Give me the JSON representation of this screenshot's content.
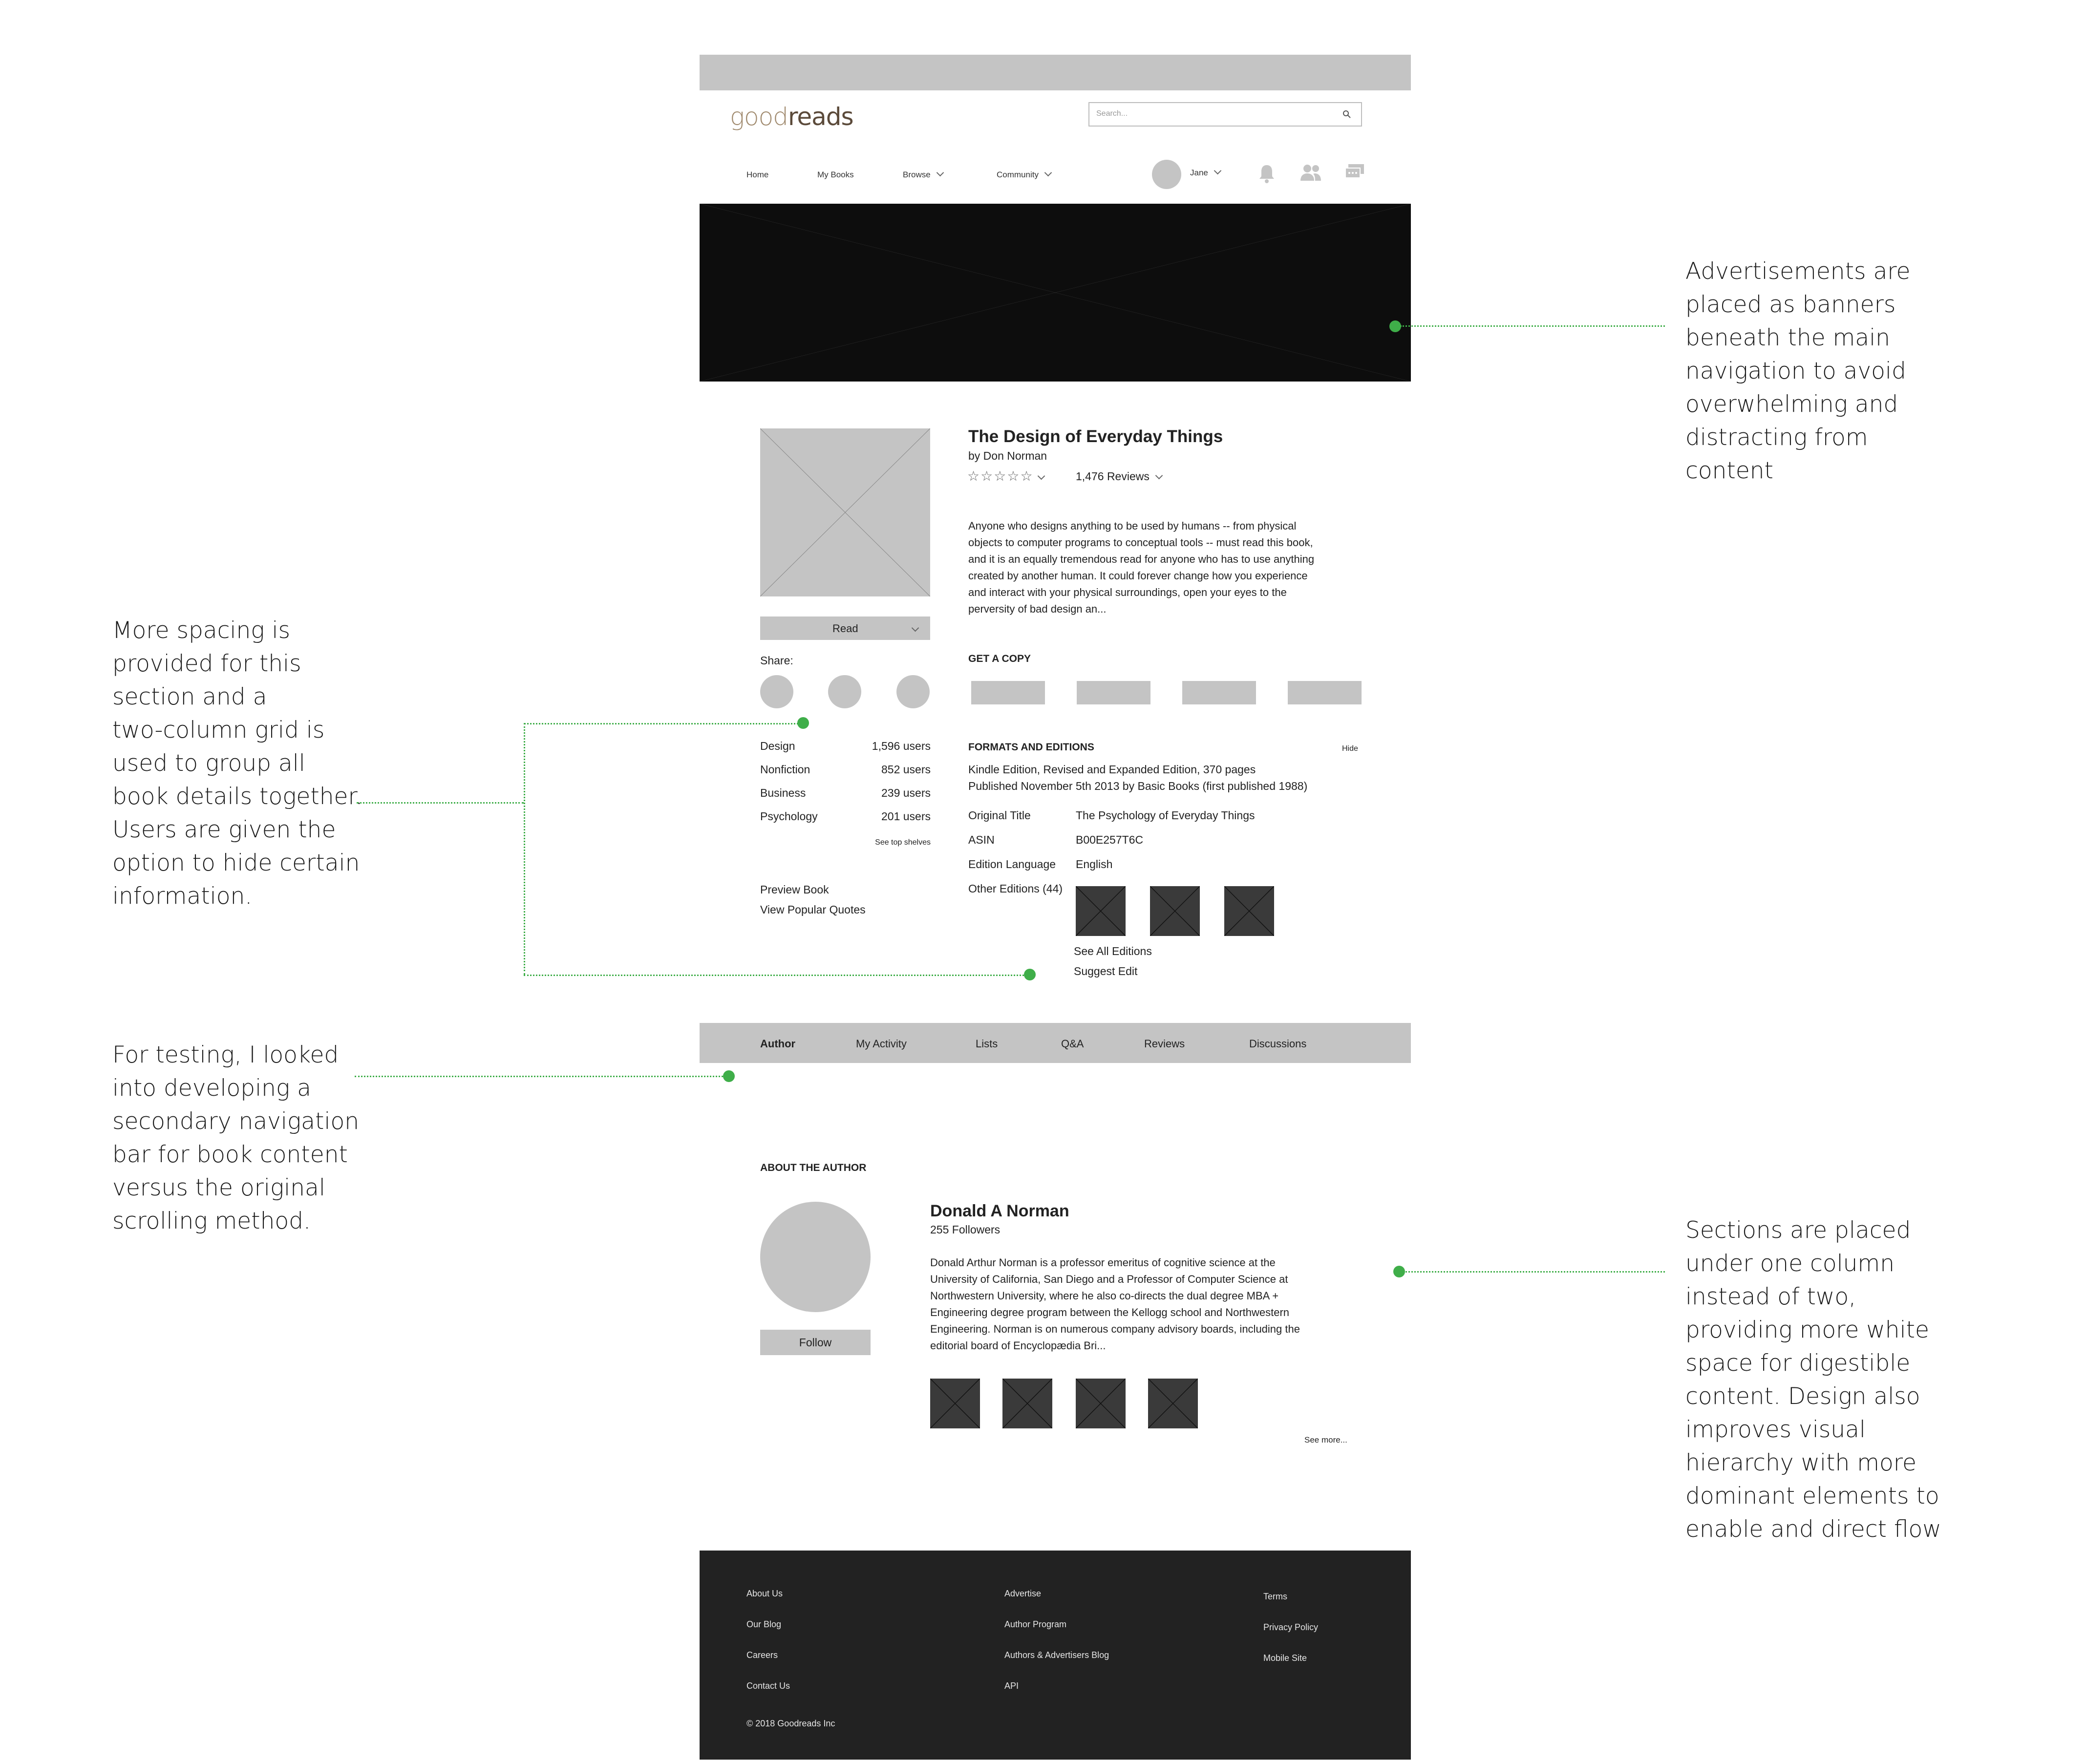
{
  "header": {
    "logo": {
      "part1": "good",
      "part2": "reads"
    },
    "search": {
      "placeholder": "Search..."
    },
    "nav": [
      "Home",
      "My Books",
      "Browse",
      "Community"
    ],
    "user_name": "Jane"
  },
  "book": {
    "title": "The Design of Everyday Things",
    "author": "by Don Norman",
    "reviews": "1,476 Reviews",
    "description_lines": [
      "Anyone who designs anything to be used by humans -- from physical",
      "objects to computer programs to conceptual tools -- must read this book,",
      "and it is an equally tremendous read for anyone who has to use anything",
      "created by another human. It could forever change how you experience",
      "and interact with your physical surroundings, open your eyes to the",
      "perversity of bad design an..."
    ],
    "read_button": "Read",
    "share_label": "Share:",
    "get_copy": "GET A COPY",
    "shelves": [
      {
        "name": "Design",
        "users": "1,596 users"
      },
      {
        "name": "Nonfiction",
        "users": "852 users"
      },
      {
        "name": "Business",
        "users": "239 users"
      },
      {
        "name": "Psychology",
        "users": "201 users"
      }
    ],
    "see_top_shelves": "See top shelves",
    "preview": "Preview Book",
    "quotes": "View Popular Quotes",
    "formats": {
      "heading": "FORMATS AND EDITIONS",
      "hide": "Hide",
      "line1": "Kindle Edition, Revised and Expanded Edition, 370 pages",
      "line2": "Published November 5th 2013 by Basic Books (first published 1988)",
      "details": [
        {
          "label": "Original Title",
          "value": "The Psychology of Everyday Things"
        },
        {
          "label": "ASIN",
          "value": "B00E257T6C"
        },
        {
          "label": "Edition Language",
          "value": "English"
        }
      ],
      "other_editions": "Other Editions (44)",
      "see_all": "See All Editions",
      "suggest_edit": "Suggest Edit"
    }
  },
  "tabs": [
    "Author",
    "My Activity",
    "Lists",
    "Q&A",
    "Reviews",
    "Discussions"
  ],
  "author": {
    "heading": "ABOUT THE AUTHOR",
    "name": "Donald A Norman",
    "followers": "255 Followers",
    "follow_button": "Follow",
    "bio_lines": [
      "Donald Arthur Norman is a professor emeritus of cognitive science at the",
      "University of California, San Diego and a Professor of Computer Science at",
      "Northwestern University, where he also co-directs the dual degree MBA +",
      "Engineering degree program between the Kellogg school and Northwestern",
      "Engineering. Norman is on numerous company advisory boards, including the",
      "editorial board of Encyclopædia Bri..."
    ],
    "see_more": "See more..."
  },
  "footer": {
    "col1": [
      "About Us",
      "Our Blog",
      "Careers",
      "Contact Us"
    ],
    "col2": [
      "Advertise",
      "Author Program",
      "Authors & Advertisers Blog",
      "API"
    ],
    "col3": [
      "Terms",
      "Privacy Policy",
      "Mobile Site"
    ],
    "copyright": "© 2018 Goodreads Inc"
  },
  "annotations": {
    "ads": [
      "Advertisements are",
      "placed as banners",
      "beneath the main",
      "navigation to avoid",
      "overwhelming and",
      "distracting from",
      "content"
    ],
    "spacing": [
      "More spacing is",
      "provided for this",
      "section and a",
      "two-column grid is",
      "used to group all",
      "book details together.",
      "Users are given the",
      "option to hide certain",
      "information."
    ],
    "testing": [
      "For testing, I looked",
      "into developing a",
      "secondary navigation",
      "bar for book content",
      "versus the original",
      "scrolling method."
    ],
    "sections": [
      "Sections are placed",
      "under one column",
      "instead of two,",
      "providing more white",
      "space for digestible",
      "content. Design also",
      "improves visual",
      "hierarchy with more",
      "dominant elements to",
      "enable and direct flow"
    ]
  },
  "colors": {
    "accent": "#3fae49",
    "placeholder": "#c4c4c4",
    "banner": "#0d0d0d",
    "footer": "#222222"
  }
}
